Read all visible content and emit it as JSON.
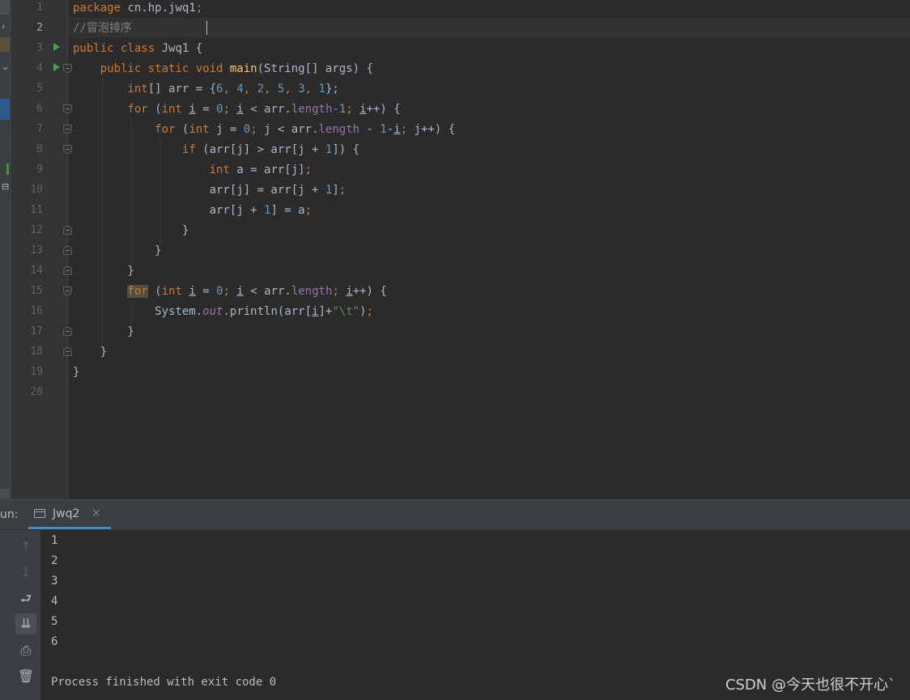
{
  "editor": {
    "line_numbers": [
      "1",
      "2",
      "3",
      "4",
      "5",
      "6",
      "7",
      "8",
      "9",
      "10",
      "11",
      "12",
      "13",
      "14",
      "15",
      "16",
      "17",
      "18",
      "19",
      "20"
    ],
    "code": {
      "l1_kw": "package",
      "l1_rest": " cn.hp.jwq1",
      "l1_semi": ";",
      "l2": "//冒泡排序",
      "l3_kw": "public class",
      "l3_rest": " Jwq1 {",
      "l4_kw": "public static void",
      "l4_fn": "main",
      "l4_rest": "(String[] args) {",
      "l5_kw": "int",
      "l5_a": "[] arr = {",
      "l5_n1": "6",
      "l5_n2": "4",
      "l5_n3": "2",
      "l5_n4": "5",
      "l5_n5": "3",
      "l5_n6": "1",
      "l5_end": "};",
      "l6_for": "for",
      "l6_int": "int",
      "l6_i1": "i",
      "l6_zero": "0",
      "l6_i2": "i",
      "l6_arr": " < arr.",
      "l6_len": "length",
      "l6_m1": "-1",
      "l6_i3": "i",
      "l7_for": "for",
      "l7_int": "int",
      "l7_j": " j = ",
      "l7_zero": "0",
      "l7_mid": " j < arr.",
      "l7_len": "length",
      "l7_minus": " - ",
      "l7_one": "1",
      "l7_i": "i",
      "l7_end": " j++) {",
      "l8_if": "if",
      "l8_a": " (arr[j] > arr[j + ",
      "l8_one": "1",
      "l8_end": "]) {",
      "l9_int": "int",
      "l9_rest": " a = arr[j]",
      "l10_a": "arr[j] = arr[j + ",
      "l10_one": "1",
      "l10_end": "]",
      "l11_a": "arr[j + ",
      "l11_one": "1",
      "l11_end": "] = a",
      "l15_for": "for",
      "l15_int": "int",
      "l15_i1": "i",
      "l15_zero": "0",
      "l15_i2": "i",
      "l15_arr": " < arr.",
      "l15_len": "length",
      "l15_i3": "i",
      "l16_a": "System.",
      "l16_out": "out",
      "l16_b": ".println(arr[",
      "l16_i": "i",
      "l16_c": "]+",
      "l16_str": "\"\\t\"",
      "l16_end": ")"
    }
  },
  "run": {
    "label": "un:",
    "tab_title": "Jwq2",
    "tab_close": "×",
    "toolbar": {
      "up": "↑",
      "down": "↓",
      "wrap": "⮐",
      "scroll_end": "⇊",
      "print": "⎙",
      "trash": "🗑"
    },
    "output": [
      "1",
      "2",
      "3",
      "4",
      "5",
      "6"
    ],
    "finish_message": "Process finished with exit code 0"
  },
  "watermark": "CSDN @今天也很不开心`"
}
